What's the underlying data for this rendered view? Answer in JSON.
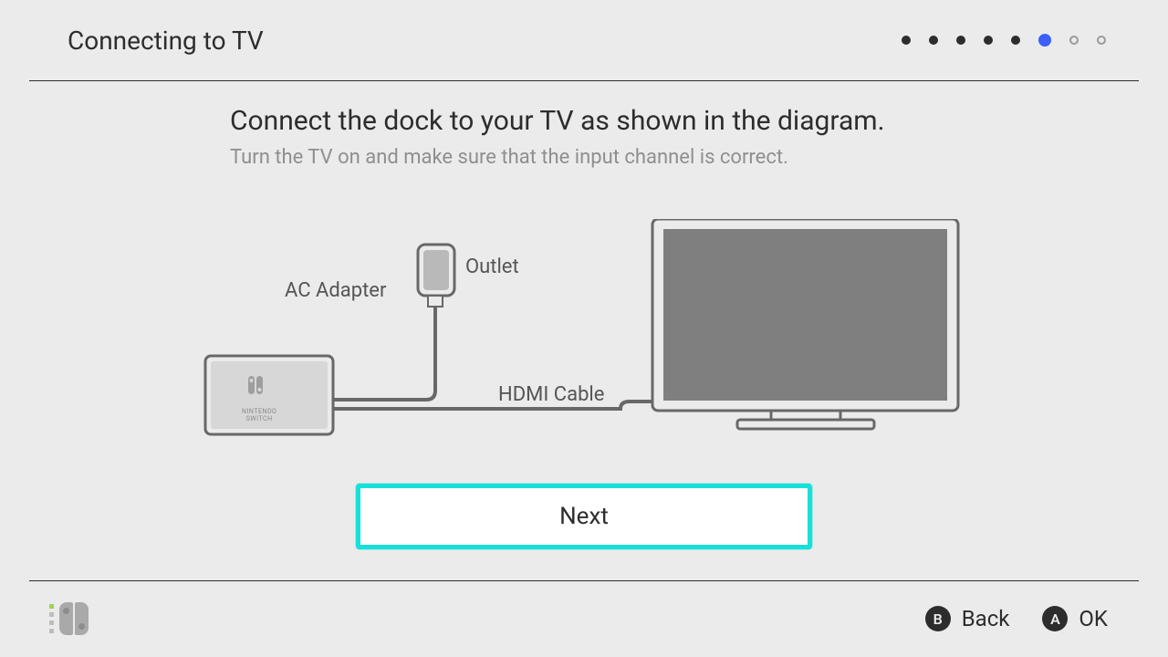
{
  "header": {
    "title": "Connecting to TV",
    "progress": {
      "total": 8,
      "current": 6
    }
  },
  "main": {
    "title": "Connect the dock to your TV as shown in the diagram.",
    "subtitle": "Turn the TV on and make sure that the input channel is correct.",
    "next_label": "Next"
  },
  "diagram": {
    "outlet_label": "Outlet",
    "ac_adapter_label": "AC Adapter",
    "hdmi_label": "HDMI Cable",
    "dock_brand_line1": "NINTENDO",
    "dock_brand_line2": "SWITCH"
  },
  "footer": {
    "back": {
      "button": "B",
      "label": "Back"
    },
    "ok": {
      "button": "A",
      "label": "OK"
    }
  },
  "colors": {
    "accent": "#18e0d8",
    "progress_active": "#3b5fff"
  }
}
